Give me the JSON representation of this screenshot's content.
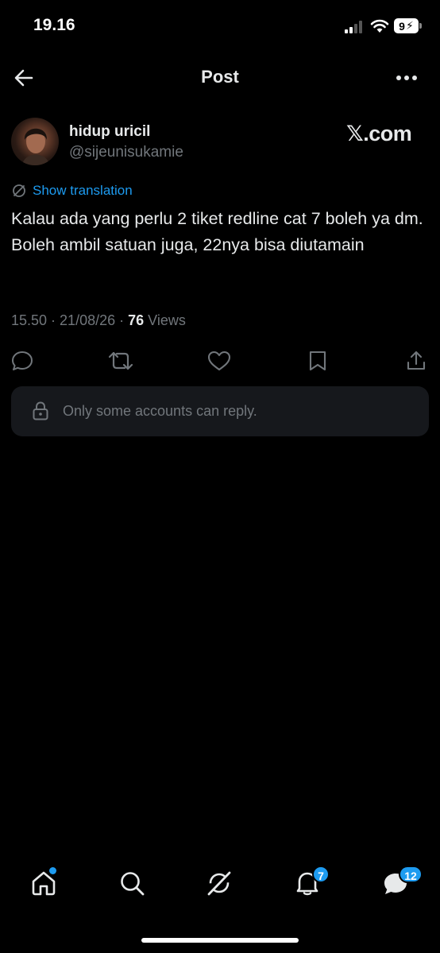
{
  "status_bar": {
    "time": "19.16",
    "battery_level": "9"
  },
  "header": {
    "title": "Post",
    "back_icon": "arrow-left-icon",
    "more_icon": "more-horizontal-icon"
  },
  "author": {
    "display_name": "hidup uricil",
    "handle": "@sijeunisukamie",
    "avatar": "avatar-photo"
  },
  "watermark": "𝕏.com",
  "translation": {
    "label": "Show translation"
  },
  "post": {
    "text": "Kalau ada yang perlu 2 tiket redline cat 7 boleh ya dm.\nBoleh ambil satuan juga, 22nya bisa diutamain"
  },
  "meta": {
    "time": "15.50",
    "date": "21/08/26",
    "views_count": "76",
    "views_label": "Views"
  },
  "actions": [
    "reply-icon",
    "repost-icon",
    "like-icon",
    "bookmark-icon",
    "share-icon"
  ],
  "reply_restriction": {
    "text": "Only some accounts can reply."
  },
  "tab_bar": {
    "items": [
      "home-icon",
      "search-icon",
      "grok-icon",
      "notifications-icon",
      "messages-icon"
    ],
    "notifications_badge": "7",
    "messages_badge": "12"
  },
  "colors": {
    "accent": "#1d9bf0",
    "background": "#000000",
    "secondary_text": "#71767b",
    "primary_text": "#e7e9ea"
  }
}
